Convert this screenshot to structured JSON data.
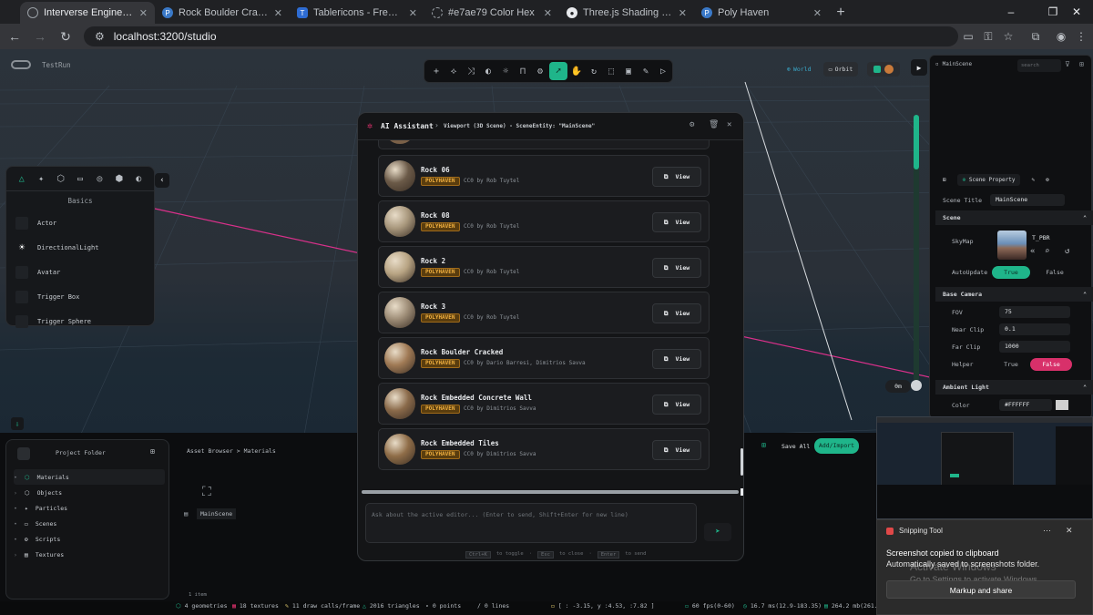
{
  "browser": {
    "tabs": [
      {
        "title": "Interverse Engine : TestRun",
        "icon": "globe-icon",
        "active": true
      },
      {
        "title": "Rock Boulder Cracked Texture -",
        "icon": "polyhaven-icon"
      },
      {
        "title": "Tablericons - Free SVG Icons",
        "icon": "tabler-icon"
      },
      {
        "title": "#e7ae79 Color Hex",
        "icon": "color-hex-icon"
      },
      {
        "title": "Three.js Shading Language - m",
        "icon": "github-icon"
      },
      {
        "title": "Poly Haven",
        "icon": "polyhaven-icon"
      }
    ],
    "url": "localhost:3200/studio"
  },
  "app": {
    "brand": "TestRun",
    "world_label": "World",
    "orbit_label": "Orbit",
    "snap_value": "0m"
  },
  "left_panel": {
    "title": "Basics",
    "items": [
      "Actor",
      "DirectionalLight",
      "Avatar",
      "Trigger Box",
      "Trigger Sphere"
    ]
  },
  "ai_assistant": {
    "title": "AI Assistant",
    "context": "Viewport (3D Scene) - SceneEntity: \"MainScene\"",
    "view_label": "View",
    "assets": [
      {
        "name": "Rock 06",
        "source": "POLYHAVEN",
        "license": "CC0 by Rob Tuytel",
        "tone": "#6b5a48"
      },
      {
        "name": "Rock 08",
        "source": "POLYHAVEN",
        "license": "CC0 by Rob Tuytel",
        "tone": "#a8977c"
      },
      {
        "name": "Rock 2",
        "source": "POLYHAVEN",
        "license": "CC0 by Rob Tuytel",
        "tone": "#b8a483"
      },
      {
        "name": "Rock 3",
        "source": "POLYHAVEN",
        "license": "CC0 by Rob Tuytel",
        "tone": "#9d8c76"
      },
      {
        "name": "Rock Boulder Cracked",
        "source": "POLYHAVEN",
        "license": "CC0 by Dario Barresi, Dimitrios Savva",
        "tone": "#a07a55"
      },
      {
        "name": "Rock Embedded Concrete Wall",
        "source": "POLYHAVEN",
        "license": "CC0 by Dimitrios Savva",
        "tone": "#8a6a4a"
      },
      {
        "name": "Rock Embedded Tiles",
        "source": "POLYHAVEN",
        "license": "CC0 by Dimitrios Savva",
        "tone": "#8f6d48"
      }
    ],
    "input_placeholder": "Ask about the active editor... (Enter to send, Shift+Enter for new line)",
    "hints": [
      {
        "key": "Ctrl+K",
        "label": "to toggle"
      },
      {
        "key": "Esc",
        "label": "to close"
      },
      {
        "key": "Enter",
        "label": "to send"
      }
    ]
  },
  "inspector": {
    "scene_name": "MainScene",
    "search_placeholder": "search",
    "tab_label": "Scene Property",
    "scene_title_label": "Scene Title",
    "scene_title_value": "MainScene",
    "scene_section": "Scene",
    "skymap_label": "SkyMap",
    "skymap_value": "T_PBR",
    "autoupdate_label": "AutoUpdate",
    "true_label": "True",
    "false_label": "False",
    "camera_section": "Base Camera",
    "fov_label": "FOV",
    "fov_value": "75",
    "near_label": "Near Clip",
    "near_value": "0.1",
    "far_label": "Far Clip",
    "far_value": "1000",
    "helper_label": "Helper",
    "ambient_section": "Ambient Light",
    "color_label": "Color",
    "color_value": "#FFFFFF"
  },
  "project": {
    "title": "Project Folder",
    "folders": [
      "Materials",
      "Objects",
      "Particles",
      "Scenes",
      "Scripts",
      "Textures"
    ],
    "breadcrumb": "Asset Browser > Materials",
    "save_all": "Save All",
    "add_import": "Add/Import",
    "asset_item": "MainScene",
    "item_count": "1 item"
  },
  "status_bar": [
    "4 geometries",
    "18 textures",
    "11 draw calls/frame",
    "2016 triangles",
    "0 points",
    "0 lines",
    "[ : -3.15, y :4.53, :7.82 ]",
    "60 fps(0-60)",
    "16.7 ms(12.9-183.35)",
    "264.2 mb(261.4-436.5)"
  ],
  "snipping": {
    "app": "Snipping Tool",
    "title": "Screenshot copied to clipboard",
    "body": "Automatically saved to screenshots folder.",
    "action": "Markup and share",
    "watermark_title": "Activate Windows",
    "watermark_body": "Go to Settings to activate Windows."
  },
  "colors": {
    "accent": "#1fb58a",
    "danger": "#d8306a",
    "badge": "#f0b040"
  }
}
